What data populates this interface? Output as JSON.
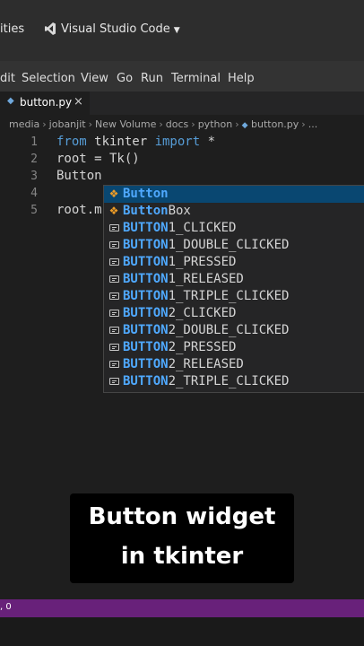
{
  "titlebar": {
    "left_label": "ities",
    "app_label": "Visual Studio Code",
    "dropdown_icon": "caret-down-icon",
    "logo_icon": "vscode-logo-icon"
  },
  "menu": {
    "items": [
      "dit",
      "Selection",
      "View",
      "Go",
      "Run",
      "Terminal",
      "Help"
    ]
  },
  "tab": {
    "label": "button.py",
    "close": "×",
    "icon": "python-file-icon"
  },
  "breadcrumb": {
    "parts": [
      "media",
      "jobanjit",
      "New Volume",
      "docs",
      "python"
    ],
    "file": "button.py",
    "trailing": "..."
  },
  "editor": {
    "line_numbers": [
      "1",
      "2",
      "3",
      "4",
      "5"
    ],
    "line1": {
      "kw1": "from",
      "mid": " tkinter ",
      "kw2": "import",
      "rest": " *"
    },
    "line2": "root = Tk()",
    "line3": "Button",
    "line5": "root.m"
  },
  "suggestions": {
    "selected_index": 0,
    "items": [
      {
        "match": "Button",
        "rest": "",
        "icon": "class-icon"
      },
      {
        "match": "Button",
        "rest": "Box",
        "icon": "class-icon"
      },
      {
        "match": "BUTTON",
        "rest": "1_CLICKED",
        "icon": "keyword-icon"
      },
      {
        "match": "BUTTON",
        "rest": "1_DOUBLE_CLICKED",
        "icon": "keyword-icon"
      },
      {
        "match": "BUTTON",
        "rest": "1_PRESSED",
        "icon": "keyword-icon"
      },
      {
        "match": "BUTTON",
        "rest": "1_RELEASED",
        "icon": "keyword-icon"
      },
      {
        "match": "BUTTON",
        "rest": "1_TRIPLE_CLICKED",
        "icon": "keyword-icon"
      },
      {
        "match": "BUTTON",
        "rest": "2_CLICKED",
        "icon": "keyword-icon"
      },
      {
        "match": "BUTTON",
        "rest": "2_DOUBLE_CLICKED",
        "icon": "keyword-icon"
      },
      {
        "match": "BUTTON",
        "rest": "2_PRESSED",
        "icon": "keyword-icon"
      },
      {
        "match": "BUTTON",
        "rest": "2_RELEASED",
        "icon": "keyword-icon"
      },
      {
        "match": "BUTTON",
        "rest": "2_TRIPLE_CLICKED",
        "icon": "keyword-icon"
      }
    ]
  },
  "caption": {
    "line1": "Button widget",
    "line2": "in tkinter"
  },
  "statusbar": {
    "text": ", 0"
  },
  "colors": {
    "status_bar": "#68217a",
    "keyword": "#569cd6",
    "match": "#4fa9ff",
    "selected": "#094771"
  }
}
